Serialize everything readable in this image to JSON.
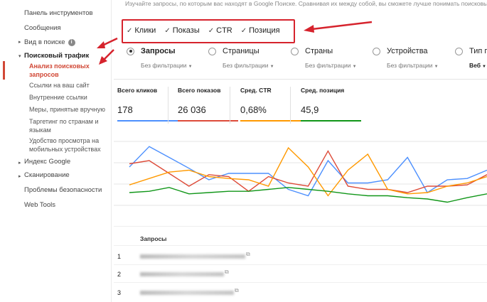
{
  "sidebar": {
    "dashboard": "Панель инструментов",
    "messages": "Сообщения",
    "search_appearance": "Вид в поиске",
    "search_traffic": "Поисковый трафик",
    "search_analytics": "Анализ поисковых запросов",
    "sub_items": [
      "Ссылки на ваш сайт",
      "Внутренние ссылки",
      "Меры, принятые вручную",
      "Таргетинг по странам и языкам",
      "Удобство просмотра на мобильных устройствах"
    ],
    "google_index": "Индекс Google",
    "crawl": "Сканирование",
    "security": "Проблемы безопасности",
    "web_tools": "Web Tools"
  },
  "intro_text": "Изучайте запросы, по которым вас находят в Google Поиске. Сравнивая их между собой, вы сможете лучше понимать поисковые трафик",
  "checkboxes": [
    "Клики",
    "Показы",
    "CTR",
    "Позиция"
  ],
  "dimensions": [
    {
      "label": "Запросы",
      "filter": "Без фильтрации",
      "selected": true
    },
    {
      "label": "Страницы",
      "filter": "Без фильтрации",
      "selected": false
    },
    {
      "label": "Страны",
      "filter": "Без фильтрации",
      "selected": false
    },
    {
      "label": "Устройства",
      "filter": "Без фильтрации",
      "selected": false
    },
    {
      "label": "Тип п",
      "filter": "Веб",
      "selected": false
    }
  ],
  "metrics": [
    {
      "label": "Всего кликов",
      "value": "178",
      "color": "#4d90fe"
    },
    {
      "label": "Всего показов",
      "value": "26 036",
      "color": "#dd4b39"
    },
    {
      "label": "Сред. CTR",
      "value": "0,68%",
      "color": "#ff9900"
    },
    {
      "label": "Сред. позиция",
      "value": "45,9",
      "color": "#109618"
    }
  ],
  "chart_data": {
    "type": "line",
    "series": [
      {
        "values": [
          0.6,
          0.92,
          0.75,
          0.58,
          0.4,
          0.5,
          0.5,
          0.5,
          0.25,
          0.15,
          0.7,
          0.35,
          0.35,
          0.4,
          0.75,
          0.2,
          0.4,
          0.42,
          0.55
        ]
      },
      {
        "values": [
          0.65,
          0.7,
          0.5,
          0.3,
          0.48,
          0.45,
          0.22,
          0.45,
          0.35,
          0.3,
          0.85,
          0.3,
          0.25,
          0.25,
          0.2,
          0.3,
          0.3,
          0.32,
          0.48
        ]
      },
      {
        "values": [
          0.32,
          0.42,
          0.52,
          0.55,
          0.45,
          0.42,
          0.4,
          0.3,
          0.9,
          0.6,
          0.15,
          0.55,
          0.8,
          0.25,
          0.18,
          0.2,
          0.3,
          0.35,
          0.45
        ]
      },
      {
        "values": [
          0.2,
          0.22,
          0.28,
          0.18,
          0.2,
          0.22,
          0.22,
          0.25,
          0.28,
          0.25,
          0.22,
          0.18,
          0.15,
          0.15,
          0.12,
          0.1,
          0.05,
          0.12,
          0.18
        ]
      }
    ],
    "series_colors": [
      "#4d90fe",
      "#dd4b39",
      "#ff9900",
      "#109618"
    ]
  },
  "table": {
    "header": "Запросы",
    "rows": [
      {
        "num": "1"
      },
      {
        "num": "2"
      },
      {
        "num": "3"
      }
    ]
  },
  "icons": {
    "info": "i",
    "external": "⧉",
    "check": "✓"
  }
}
